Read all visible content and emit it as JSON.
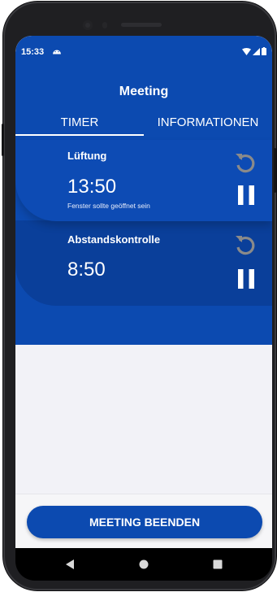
{
  "status_bar": {
    "time": "15:33",
    "notification_icon": "android-debug-icon",
    "icons": [
      "wifi-icon",
      "signal-icon",
      "battery-icon"
    ]
  },
  "header": {
    "title": "Meeting"
  },
  "tabs": [
    {
      "label": "TIMER",
      "selected": true
    },
    {
      "label": "INFORMATIONEN",
      "selected": false
    }
  ],
  "timers": [
    {
      "label": "Lüftung",
      "time": "13:50",
      "subtitle": "Fenster sollte geöffnet sein",
      "reset_icon": "reset-icon",
      "pause_icon": "pause-icon"
    },
    {
      "label": "Abstandskontrolle",
      "time": "8:50",
      "subtitle": "",
      "reset_icon": "reset-icon",
      "pause_icon": "pause-icon"
    }
  ],
  "footer": {
    "end_button_label": "MEETING BEENDEN"
  },
  "colors": {
    "primary": "#0c4ab0",
    "primary_dark": "#0a3f9a",
    "background": "#f2f2f7",
    "reset_icon": "#8a8a8a"
  },
  "navigation": [
    "back-icon",
    "home-icon",
    "recents-icon"
  ]
}
